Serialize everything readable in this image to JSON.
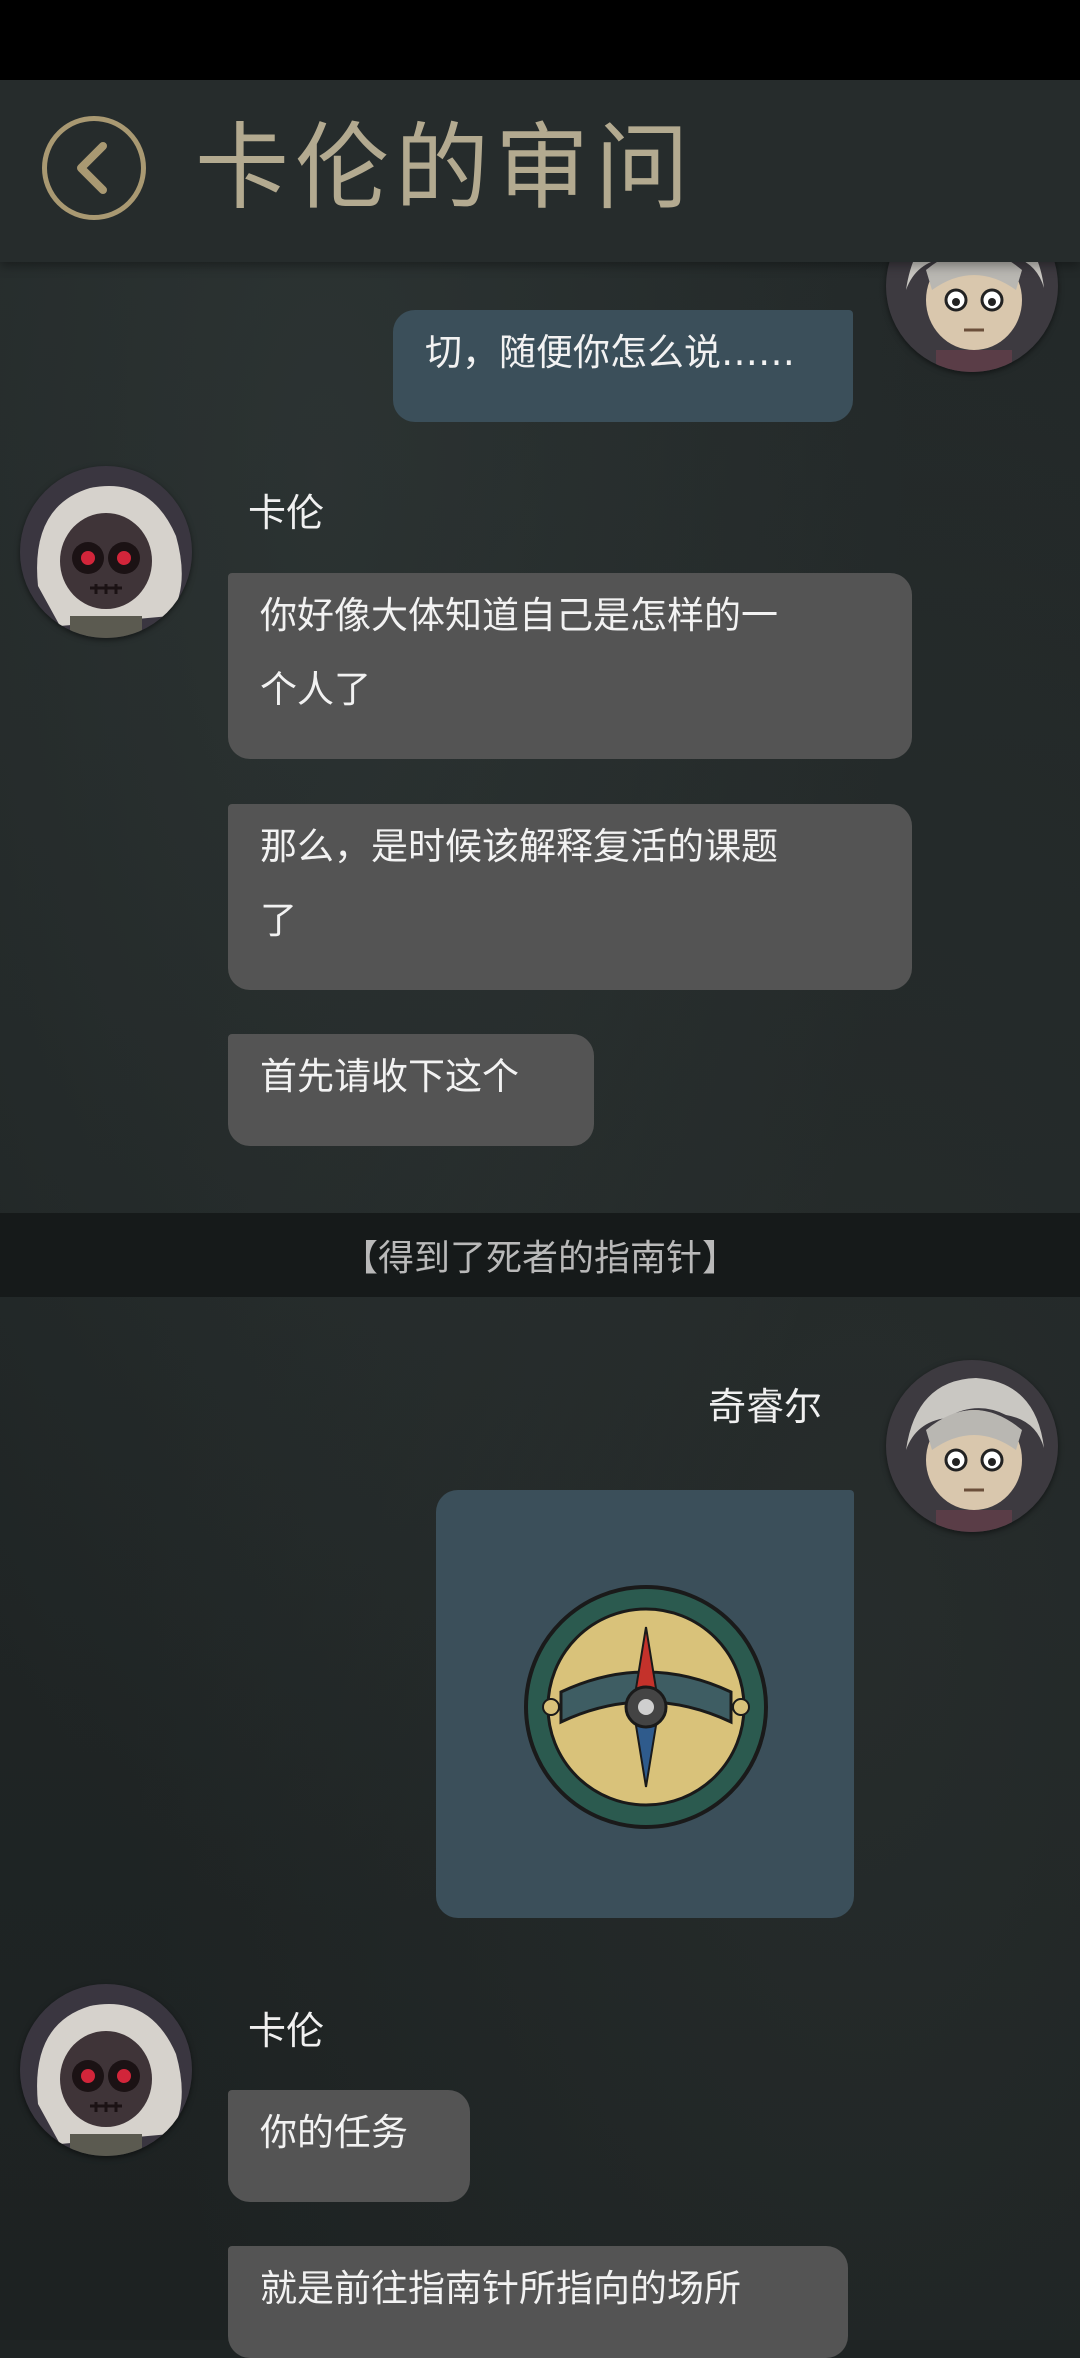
{
  "header": {
    "title": "卡伦的审问",
    "back_icon": "back-chevron-icon"
  },
  "colors": {
    "title": "#b3aa90",
    "left_bubble": "#545454",
    "right_bubble": "#3b4f5a",
    "system_bar": "#161a1a"
  },
  "messages": [
    {
      "sender": "奇睿尔",
      "side": "right",
      "text": "切，随便你怎么说……"
    },
    {
      "sender": "卡伦",
      "side": "left",
      "text_lines": [
        "你好像大体知道自己是怎样的一",
        "个人了"
      ]
    },
    {
      "sender": "卡伦",
      "side": "left",
      "text_lines": [
        "那么，是时候该解释复活的课题",
        "了"
      ]
    },
    {
      "sender": "卡伦",
      "side": "left",
      "text": "首先请收下这个"
    }
  ],
  "system_message": "【得到了死者的指南针】",
  "second_block": {
    "right_sender": "奇睿尔",
    "image_item": "compass-icon",
    "left_sender": "卡伦",
    "left_messages": [
      "你的任务",
      "就是前往指南针所指向的场所"
    ]
  }
}
